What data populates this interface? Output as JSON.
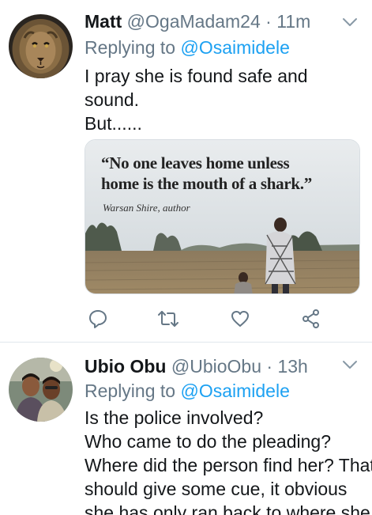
{
  "tweets": [
    {
      "author": {
        "name": "Matt",
        "handle": "@OgaMadam24",
        "separator": "·",
        "time": "11m"
      },
      "replying": {
        "prefix": "Replying to",
        "mention": "@Osaimidele"
      },
      "text": [
        "I pray she is found safe and sound.",
        "But......"
      ],
      "media": {
        "quote_line1": "“No one leaves home unless",
        "quote_line2": "home is the mouth of a shark.”",
        "attribution": "Warsan Shire, author"
      },
      "actions": [
        "reply-icon",
        "retweet-icon",
        "like-icon",
        "share-icon"
      ]
    },
    {
      "author": {
        "name": "Ubio Obu",
        "handle": "@UbioObu",
        "separator": "·",
        "time": "13h"
      },
      "replying": {
        "prefix": "Replying to",
        "mention": "@Osaimidele"
      },
      "text": [
        "Is the police involved?",
        "Who came to do the pleading?",
        "Where did the person find her? That",
        "should give some cue, it obvious",
        "she has only ran back to where she"
      ]
    }
  ],
  "colors": {
    "link": "#1da1f2",
    "muted": "#657786",
    "text": "#14171a",
    "divider": "#e1e8ed"
  }
}
